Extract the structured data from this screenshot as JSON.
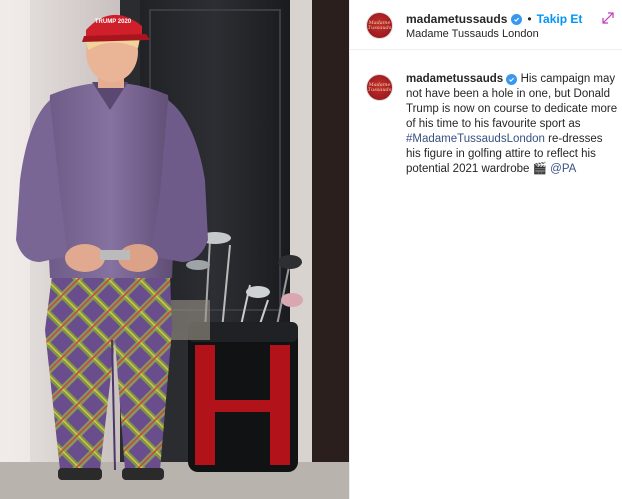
{
  "post": {
    "username": "madametussauds",
    "separator": "•",
    "follow_label": "Takip Et",
    "location": "Madame Tussauds London",
    "avatar_text": "Madame\nTussauds",
    "caption": {
      "username": "madametussauds",
      "text_before": "His campaign may not have been a hole in one, but Donald Trump is now on course to dedicate more of his time to his favourite sport as",
      "hashtag": "#MadameTussaudsLondon",
      "text_after": "re-dresses his figure in golfing attire to reflect his potential 2021 wardrobe",
      "emoji": "🎬",
      "mention": "@PA"
    }
  },
  "photo": {
    "cap_text": "TRUMP 2020"
  },
  "colors": {
    "brand_red": "#9e1b20",
    "link_blue": "#0095f6",
    "verified_blue": "#3897f0",
    "text": "#262626"
  },
  "icons": {
    "verified": "verified-badge-icon",
    "expand": "expand-arrows-icon",
    "clapper": "clapper-board-icon"
  }
}
